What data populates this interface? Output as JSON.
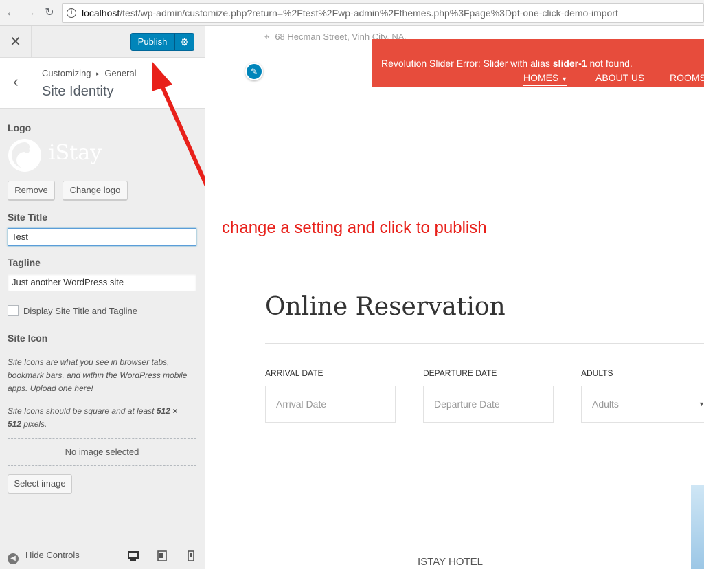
{
  "browser": {
    "url_host": "localhost",
    "url_rest": "/test/wp-admin/customize.php?return=%2Ftest%2Fwp-admin%2Fthemes.php%3Fpage%3Dpt-one-click-demo-import"
  },
  "customizer": {
    "publish_label": "Publish",
    "breadcrumb_root": "Customizing",
    "breadcrumb_separator": "▸",
    "breadcrumb_parent": "General",
    "section_title": "Site Identity",
    "logo": {
      "label": "Logo",
      "logo_text": "iStay",
      "remove_label": "Remove",
      "change_label": "Change logo"
    },
    "site_title": {
      "label": "Site Title",
      "value": "Test"
    },
    "tagline": {
      "label": "Tagline",
      "value": "Just another WordPress site"
    },
    "display_title_tagline": {
      "label": "Display Site Title and Tagline",
      "checked": false
    },
    "site_icon": {
      "label": "Site Icon",
      "description_1": "Site Icons are what you see in browser tabs, bookmark bars, and within the WordPress mobile apps. Upload one here!",
      "description_2_prefix": "Site Icons should be square and at least ",
      "description_2_size": "512 × 512",
      "description_2_suffix": " pixels.",
      "no_image": "No image selected",
      "select_label": "Select image"
    },
    "footer": {
      "hide_controls": "Hide Controls"
    }
  },
  "preview": {
    "address": "68 Hecman Street, Vinh City, NA.",
    "error_prefix": "Revolution Slider Error: Slider with alias ",
    "error_alias": "slider-1",
    "error_suffix": " not found.",
    "nav": [
      "HOMES",
      "ABOUT US",
      "ROOMS"
    ],
    "annotation": "change a setting and click to publish",
    "reservation_title": "Online Reservation",
    "fields": [
      {
        "label": "ARRIVAL DATE",
        "placeholder": "Arrival Date"
      },
      {
        "label": "DEPARTURE DATE",
        "placeholder": "Departure Date"
      },
      {
        "label": "ADULTS",
        "placeholder": "Adults"
      }
    ],
    "hotel_name": "ISTAY HOTEL"
  },
  "colors": {
    "publish_blue": "#0085ba",
    "error_red": "#e74c3c",
    "annotation_red": "#e8201a"
  }
}
